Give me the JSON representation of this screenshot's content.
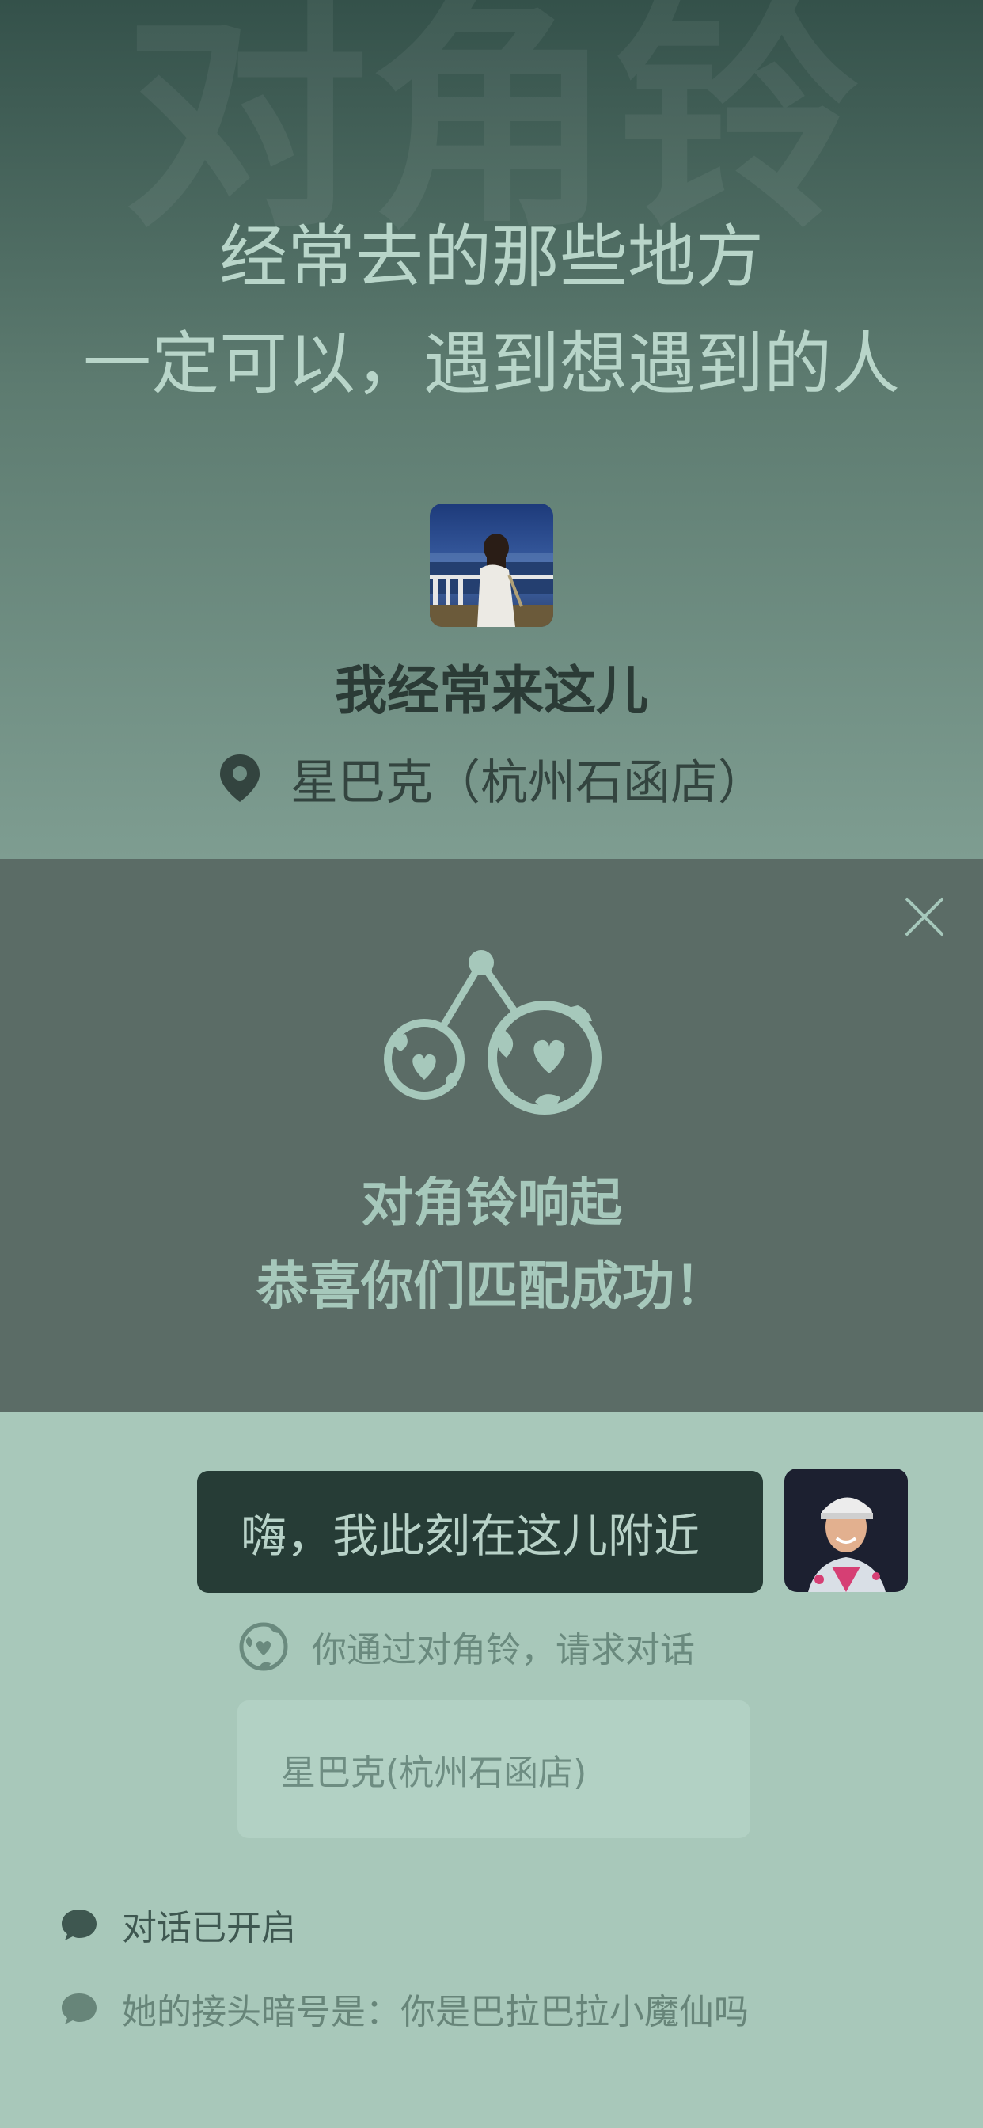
{
  "hero": {
    "watermark": "对角铃",
    "slogan_line1": "经常去的那些地方",
    "slogan_line2": "一定可以，遇到想遇到的人",
    "place_title": "我经常来这儿",
    "location_icon": "location-pin-icon",
    "location_name": "星巴克（杭州石函店）"
  },
  "match": {
    "close_icon": "close-icon",
    "bell_icon": "diagonal-bell-icon",
    "line1": "对角铃响起",
    "line2": "恭喜你们匹配成功！"
  },
  "chat": {
    "message": "嗨，我此刻在这儿附近",
    "system_note": "你通过对角铃，请求对话",
    "place_card": "星巴克(杭州石函店)",
    "status_opened": "对话已开启",
    "status_code": "她的接头暗号是：你是巴拉巴拉小魔仙吗"
  },
  "colors": {
    "hero_top": "#34514a",
    "hero_bottom": "#7e9d91",
    "overlay": "#5b6c66",
    "chat_bg": "#a8c8ba",
    "bubble": "#263c36",
    "accent_text": "#a6c8bb"
  }
}
